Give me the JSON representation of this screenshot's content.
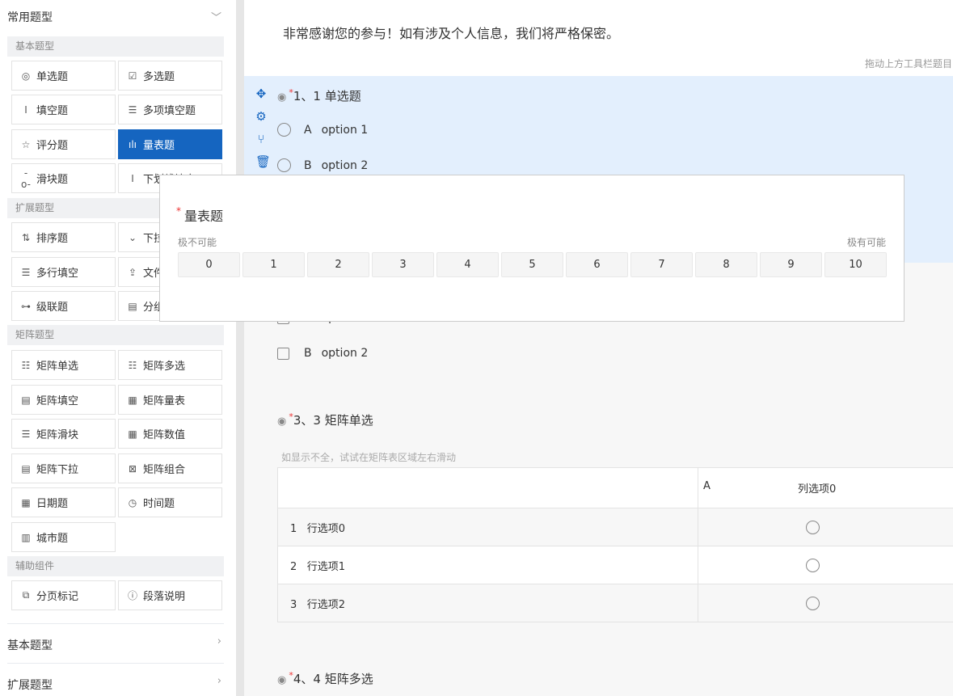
{
  "sidebar": {
    "common_title": "常用题型",
    "groups": [
      {
        "label": "基本题型",
        "items": [
          "单选题",
          "多选题",
          "填空题",
          "多项填空题",
          "评分题",
          "量表题",
          "滑块题",
          "下划线填空"
        ]
      },
      {
        "label": "扩展题型",
        "items": [
          "排序题",
          "下拉题",
          "多行填空",
          "文件上传",
          "级联题",
          "分组题"
        ]
      },
      {
        "label": "矩阵题型",
        "items": [
          "矩阵单选",
          "矩阵多选",
          "矩阵填空",
          "矩阵量表",
          "矩阵滑块",
          "矩阵数值",
          "矩阵下拉",
          "矩阵组合",
          "日期题",
          "时间题",
          "城市题"
        ]
      },
      {
        "label": "辅助组件",
        "items": [
          "分页标记",
          "段落说明"
        ]
      }
    ],
    "active_item": "量表题",
    "collapsed_sections": [
      "基本题型",
      "扩展题型"
    ]
  },
  "main": {
    "intro": "非常感谢您的参与！如有涉及个人信息，我们将严格保密。",
    "drag_hint": "拖动上方工具栏题目",
    "q1": {
      "title": "1、1  单选题",
      "options": [
        {
          "letter": "A",
          "text": "option 1"
        },
        {
          "letter": "B",
          "text": "option 2"
        }
      ]
    },
    "q2": {
      "options": [
        {
          "letter": "A",
          "text": "option 1"
        },
        {
          "letter": "B",
          "text": "option 2"
        }
      ]
    },
    "q3": {
      "title": "3、3  矩阵单选",
      "hint": "如显示不全，试试在矩阵表区域左右滑动",
      "col_letter": "A",
      "col_label": "列选项0",
      "rows": [
        {
          "num": "1",
          "label": "行选项0"
        },
        {
          "num": "2",
          "label": "行选项1"
        },
        {
          "num": "3",
          "label": "行选项2"
        }
      ]
    },
    "q4": {
      "title": "4、4  矩阵多选"
    },
    "required_mark": "*"
  },
  "popup": {
    "title": "量表题",
    "low_label": "极不可能",
    "high_label": "极有可能",
    "scale": [
      "0",
      "1",
      "2",
      "3",
      "4",
      "5",
      "6",
      "7",
      "8",
      "9",
      "10"
    ]
  },
  "colors": {
    "accent": "#1565c0",
    "selected_bg": "#e3effd",
    "required": "#ee3333"
  }
}
